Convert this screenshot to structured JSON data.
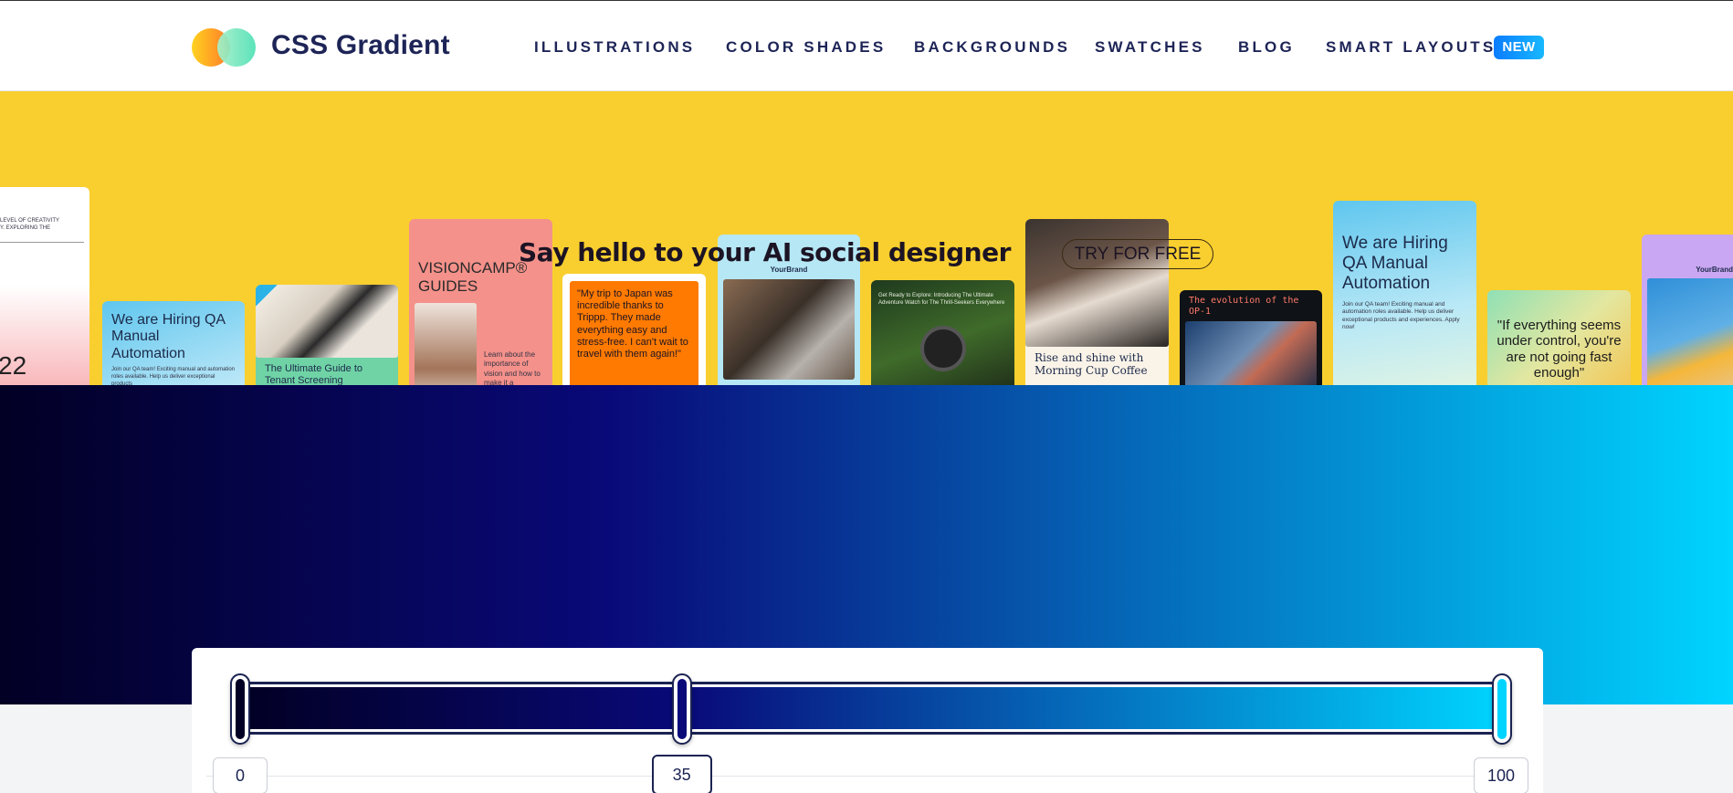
{
  "header": {
    "brand": "CSS Gradient",
    "nav": [
      {
        "label": "ILLUSTRATIONS"
      },
      {
        "label": "COLOR SHADES"
      },
      {
        "label": "BACKGROUNDS"
      },
      {
        "label": "SWATCHES"
      },
      {
        "label": "BLOG"
      },
      {
        "label": "SMART LAYOUTS"
      }
    ],
    "new_badge": "NEW"
  },
  "ad": {
    "headline": "Say hello to your AI social designer",
    "cta": "TRY FOR FREE",
    "cards": {
      "c0_small": "LEVEL OF CREATIVITY\nY. EXPLORING THE",
      "c0_number": "22",
      "c1_title": "We are Hiring QA Manual Automation",
      "c1_small": "Join our QA team! Exciting manual and automation roles available. Help us deliver exceptional products",
      "c2_title": "The Ultimate Guide to Tenant Screening",
      "c3_title": "VISIONCAMP® GUIDES",
      "c3_small": "Learn about the importance of vision and how to make it a",
      "c4_quote": "\"My trip to Japan was incredible thanks to Trippp. They made everything easy and stress-free. I can't wait to travel with them again!\"",
      "c5_brand": "YourBrand",
      "c6_small": "Get Ready to Explore: Introducing The Ultimate Adventure Watch for The Thrill-Seekers Everywhere",
      "c7_title": "Rise and shine with Morning Cup Coffee",
      "c8_title": "The evolution of the OP-1",
      "c9_title": "We are Hiring QA Manual Automation",
      "c9_small": "Join our QA team! Exciting manual and automation roles available. Help us deliver exceptional products and experiences. Apply now!",
      "c10_quote": "\"If everything seems under control, you're are not going fast enough\"",
      "c11_brand": "YourBrand"
    }
  },
  "gradient": {
    "stops": [
      {
        "position": 0,
        "color": "#020024",
        "label": "0"
      },
      {
        "position": 35,
        "color": "#090979",
        "label": "35"
      },
      {
        "position": 100,
        "color": "#00d4ff",
        "label": "100"
      }
    ],
    "active_stop": 35
  }
}
